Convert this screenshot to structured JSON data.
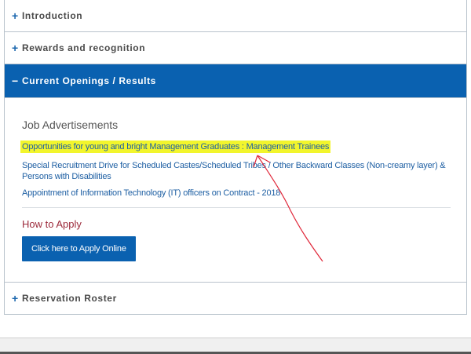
{
  "accordion": {
    "items": [
      {
        "sign": "+",
        "label": "Introduction"
      },
      {
        "sign": "+",
        "label": "Rewards and recognition"
      },
      {
        "sign": "−",
        "label": "Current Openings / Results"
      },
      {
        "sign": "+",
        "label": "Reservation Roster"
      }
    ]
  },
  "openings": {
    "title": "Job Advertisements",
    "links": [
      "Opportunities for young and bright Management Graduates : Management Trainees",
      "Special Recruitment Drive for Scheduled Castes/Scheduled Tribes / Other Backward Classes (Non-creamy layer) & Persons with Disabilities",
      "Appointment of Information Technology (IT) officers on Contract - 2018"
    ],
    "how_to_apply": "How to Apply",
    "apply_button": "Click here to Apply Online"
  },
  "colors": {
    "accent": "#0a61b0",
    "highlight": "#f2f52c",
    "annotation": "#e0283a"
  }
}
